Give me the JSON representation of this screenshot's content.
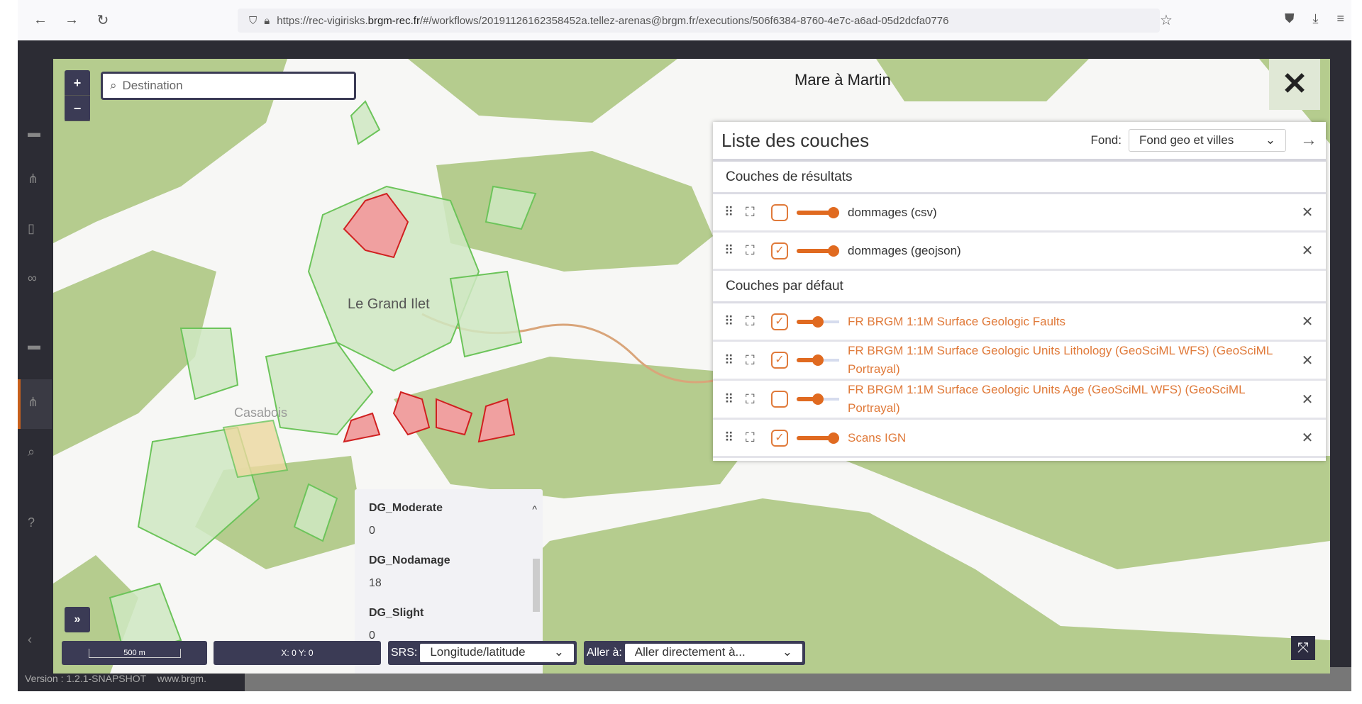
{
  "browser": {
    "url_prefix": "https://rec-vigirisks.",
    "url_domain": "brgm-rec.fr",
    "url_rest": "/#/workflows/20191126162358452a.tellez-arenas@brgm.fr/executions/506f6384-8760-4e7c-a6ad-05d2dcfa0776"
  },
  "map": {
    "search_placeholder": "Destination",
    "place_labels": [
      "Mare à Martin",
      "Le Grand Ilet",
      "Casabois"
    ],
    "zoom_in": "+",
    "zoom_out": "−",
    "close": "✕",
    "expand": "»"
  },
  "layers": {
    "title": "Liste des couches",
    "fond_label": "Fond:",
    "fond_value": "Fond geo et villes",
    "sections": [
      {
        "title": "Couches de résultats",
        "items": [
          {
            "name": "dommages (csv)",
            "checked": false,
            "opacity": 1.0,
            "style": "normal"
          },
          {
            "name": "dommages (geojson)",
            "checked": true,
            "opacity": 1.0,
            "style": "normal"
          }
        ]
      },
      {
        "title": "Couches par défaut",
        "items": [
          {
            "name": "FR BRGM 1:1M Surface Geologic Faults",
            "checked": true,
            "opacity": 0.5,
            "style": "orange"
          },
          {
            "name": "FR BRGM 1:1M Surface Geologic Units Lithology (GeoSciML WFS) (GeoSciML Portrayal)",
            "checked": true,
            "opacity": 0.5,
            "style": "orange"
          },
          {
            "name": "FR BRGM 1:1M Surface Geologic Units Age (GeoSciML WFS) (GeoSciML Portrayal)",
            "checked": false,
            "opacity": 0.5,
            "style": "orange"
          },
          {
            "name": "Scans IGN",
            "checked": true,
            "opacity": 1.0,
            "style": "orange"
          }
        ]
      }
    ]
  },
  "popup": {
    "fields": [
      {
        "key": "DG_Moderate",
        "value": "0"
      },
      {
        "key": "DG_Nodamage",
        "value": "18"
      },
      {
        "key": "DG_Slight",
        "value": "0"
      }
    ]
  },
  "toolbar": {
    "scale": "500 m",
    "coords": "X: 0 Y: 0",
    "srs_label": "SRS:",
    "srs_value": "Longitude/latitude",
    "goto_label": "Aller à:",
    "goto_value": "Aller directement à..."
  },
  "footer": {
    "version": "Version : 1.2.1-SNAPSHOT",
    "site": "www.brgm."
  },
  "colors": {
    "accent": "#e07a3a",
    "forest": "#b5cc8e",
    "damage_red": "#e04848",
    "building_green": "#8cd27a"
  }
}
